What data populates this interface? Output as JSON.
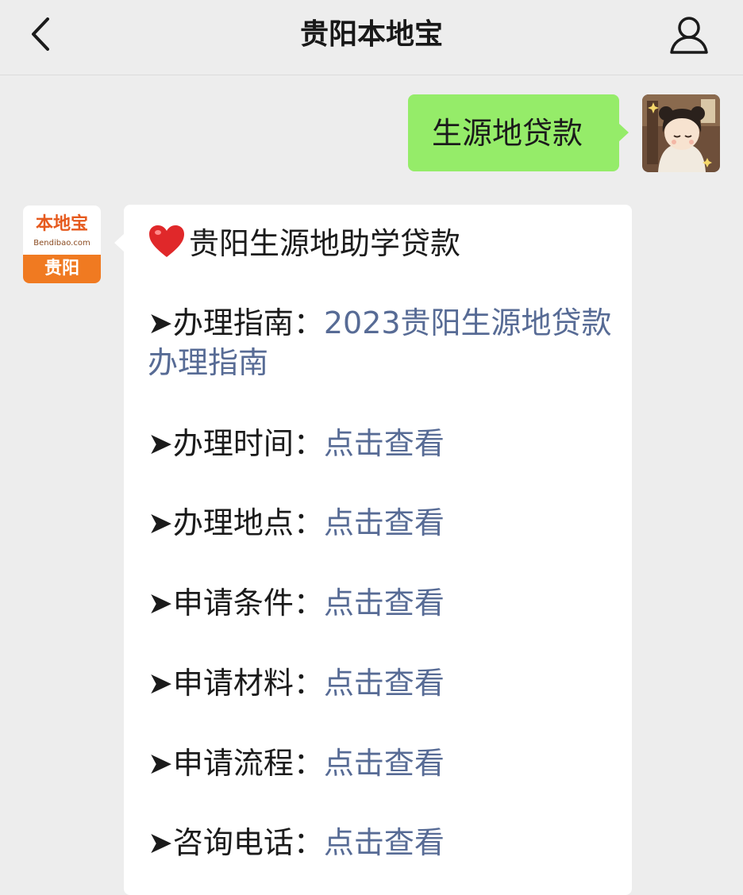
{
  "nav": {
    "title": "贵阳本地宝",
    "back_icon": "chevron-left-icon",
    "profile_icon": "person-icon"
  },
  "outgoing": {
    "text": "生源地贷款"
  },
  "bot": {
    "logo_name": "本地宝",
    "logo_domain": "Bendibao.com",
    "logo_city": "贵阳"
  },
  "message": {
    "heading": "贵阳生源地助学贷款",
    "heading_icon": "red-heart-icon",
    "rows": [
      {
        "label": "➤办理指南：",
        "link": "2023贵阳生源地贷款办理指南"
      },
      {
        "label": "➤办理时间：",
        "link": "点击查看"
      },
      {
        "label": "➤办理地点：",
        "link": "点击查看"
      },
      {
        "label": "➤申请条件：",
        "link": "点击查看"
      },
      {
        "label": "➤申请材料：",
        "link": "点击查看"
      },
      {
        "label": "➤申请流程：",
        "link": "点击查看"
      },
      {
        "label": "➤咨询电话：",
        "link": "点击查看"
      }
    ]
  },
  "colors": {
    "background": "#ededed",
    "outgoing_bubble": "#95ec69",
    "link": "#576b95",
    "logo_orange": "#f07a21"
  }
}
